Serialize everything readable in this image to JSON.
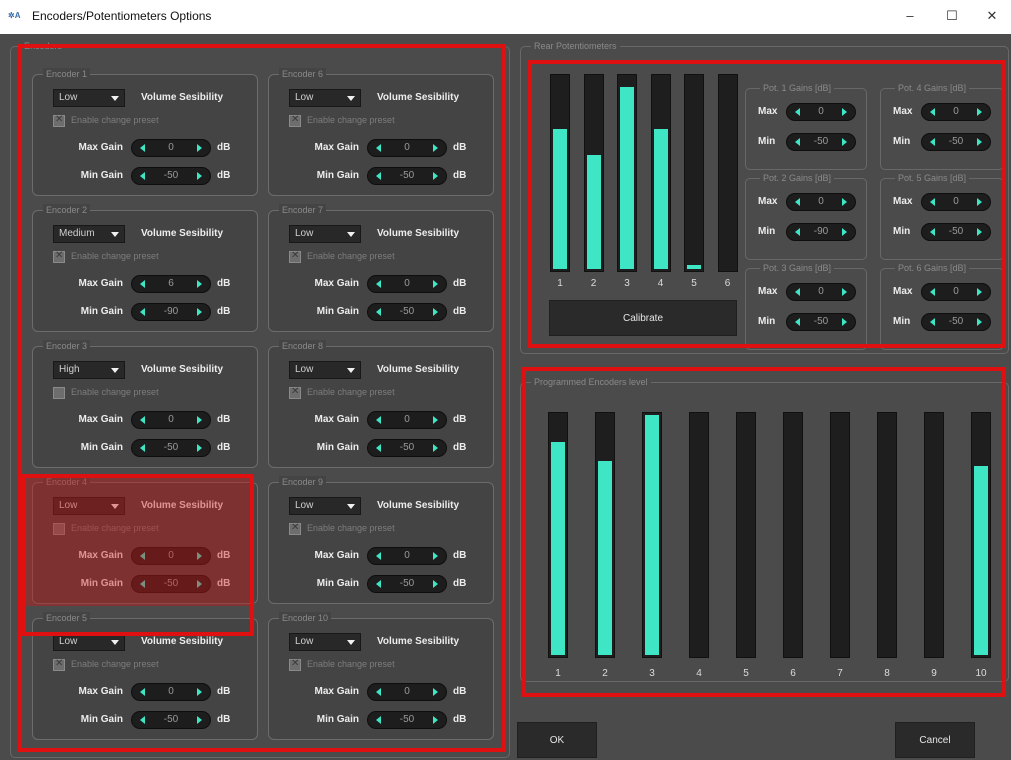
{
  "window": {
    "title": "Encoders/Potentiometers Options",
    "minimize_glyph": "–",
    "maximize_glyph": "☐",
    "close_glyph": "✕"
  },
  "encoders_group": {
    "title": "Encoders"
  },
  "vol_label": "Volume Sesibility",
  "enable_label": "Enable change preset",
  "max_gain_label": "Max Gain",
  "min_gain_label": "Min Gain",
  "unit": "dB",
  "encoders": [
    {
      "title": "Encoder 1",
      "sensitivity": "Low",
      "preset_enabled": true,
      "max_gain": "0",
      "min_gain": "-50"
    },
    {
      "title": "Encoder 2",
      "sensitivity": "Medium",
      "preset_enabled": true,
      "max_gain": "6",
      "min_gain": "-90"
    },
    {
      "title": "Encoder 3",
      "sensitivity": "High",
      "preset_enabled": false,
      "max_gain": "0",
      "min_gain": "-50"
    },
    {
      "title": "Encoder 4",
      "sensitivity": "Low",
      "preset_enabled": false,
      "max_gain": "0",
      "min_gain": "-50"
    },
    {
      "title": "Encoder 5",
      "sensitivity": "Low",
      "preset_enabled": true,
      "max_gain": "0",
      "min_gain": "-50"
    },
    {
      "title": "Encoder 6",
      "sensitivity": "Low",
      "preset_enabled": true,
      "max_gain": "0",
      "min_gain": "-50"
    },
    {
      "title": "Encoder 7",
      "sensitivity": "Low",
      "preset_enabled": true,
      "max_gain": "0",
      "min_gain": "-50"
    },
    {
      "title": "Encoder 8",
      "sensitivity": "Low",
      "preset_enabled": true,
      "max_gain": "0",
      "min_gain": "-50"
    },
    {
      "title": "Encoder 9",
      "sensitivity": "Low",
      "preset_enabled": true,
      "max_gain": "0",
      "min_gain": "-50"
    },
    {
      "title": "Encoder 10",
      "sensitivity": "Low",
      "preset_enabled": true,
      "max_gain": "0",
      "min_gain": "-50"
    }
  ],
  "rear": {
    "title": "Rear Potentiometers",
    "bars": [
      {
        "label": "1",
        "level": 0.72
      },
      {
        "label": "2",
        "level": 0.59
      },
      {
        "label": "3",
        "level": 0.94
      },
      {
        "label": "4",
        "level": 0.72
      },
      {
        "label": "5",
        "level": 0.02
      },
      {
        "label": "6",
        "level": 0.0
      }
    ],
    "calibrate_label": "Calibrate",
    "max_label": "Max",
    "min_label": "Min",
    "pots": [
      {
        "title": "Pot. 1 Gains [dB]",
        "max": "0",
        "min": "-50"
      },
      {
        "title": "Pot. 2 Gains [dB]",
        "max": "0",
        "min": "-90"
      },
      {
        "title": "Pot. 3 Gains [dB]",
        "max": "0",
        "min": "-50"
      },
      {
        "title": "Pot. 4 Gains [dB]",
        "max": "0",
        "min": "-50"
      },
      {
        "title": "Pot. 5 Gains [dB]",
        "max": "0",
        "min": "-50"
      },
      {
        "title": "Pot. 6 Gains [dB]",
        "max": "0",
        "min": "-50"
      }
    ]
  },
  "programmed": {
    "title": "Programmed Encoders level",
    "bars": [
      {
        "label": "1",
        "level": 0.88
      },
      {
        "label": "2",
        "level": 0.8
      },
      {
        "label": "3",
        "level": 0.99
      },
      {
        "label": "4",
        "level": 0.0
      },
      {
        "label": "5",
        "level": 0.0
      },
      {
        "label": "6",
        "level": 0.0
      },
      {
        "label": "7",
        "level": 0.0
      },
      {
        "label": "8",
        "level": 0.0
      },
      {
        "label": "9",
        "level": 0.0
      },
      {
        "label": "10",
        "level": 0.78
      }
    ]
  },
  "ok_label": "OK",
  "cancel_label": "Cancel",
  "colors": {
    "accent": "#3ee6c6",
    "highlight": "#e01010",
    "background": "#4b4b4b"
  }
}
